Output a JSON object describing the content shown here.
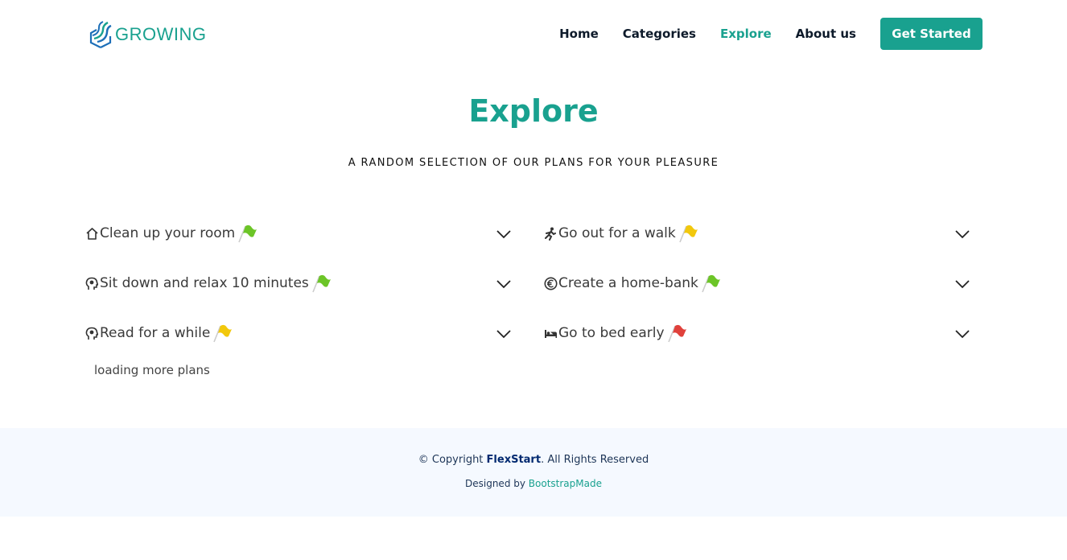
{
  "brand": {
    "name": "GROWING",
    "logo_icon": "growing-logo-icon",
    "accent": "#19a18f"
  },
  "nav": {
    "items": [
      {
        "label": "Home"
      },
      {
        "label": "Categories"
      },
      {
        "label": "Explore"
      },
      {
        "label": "About us"
      }
    ],
    "active": "Explore",
    "cta_label": "Get Started"
  },
  "explore": {
    "title": "Explore",
    "subtitle": "A RANDOM SELECTION OF OUR PLANS FOR YOUR PLEASURE",
    "plans": [
      {
        "label": "Clean up your room",
        "icon": "house-icon",
        "flag_color": "#6cc527"
      },
      {
        "label": "Go out for a walk",
        "icon": "running-person-icon",
        "flag_color": "#f2c80c"
      },
      {
        "label": "Sit down and relax 10 minutes",
        "icon": "head-icon",
        "flag_color": "#6cc527"
      },
      {
        "label": "Create a home-bank",
        "icon": "euro-icon",
        "flag_color": "#6cc527"
      },
      {
        "label": "Read for a while",
        "icon": "head-icon",
        "flag_color": "#f2c80c"
      },
      {
        "label": "Go to bed early",
        "icon": "bed-icon",
        "flag_color": "#e0413b"
      }
    ],
    "loading_text": "loading more plans"
  },
  "footer": {
    "copyright_prefix": "© Copyright ",
    "brand": "FlexStart",
    "copyright_suffix": ". All Rights Reserved",
    "designed_prefix": "Designed by ",
    "designer": "BootstrapMade"
  }
}
